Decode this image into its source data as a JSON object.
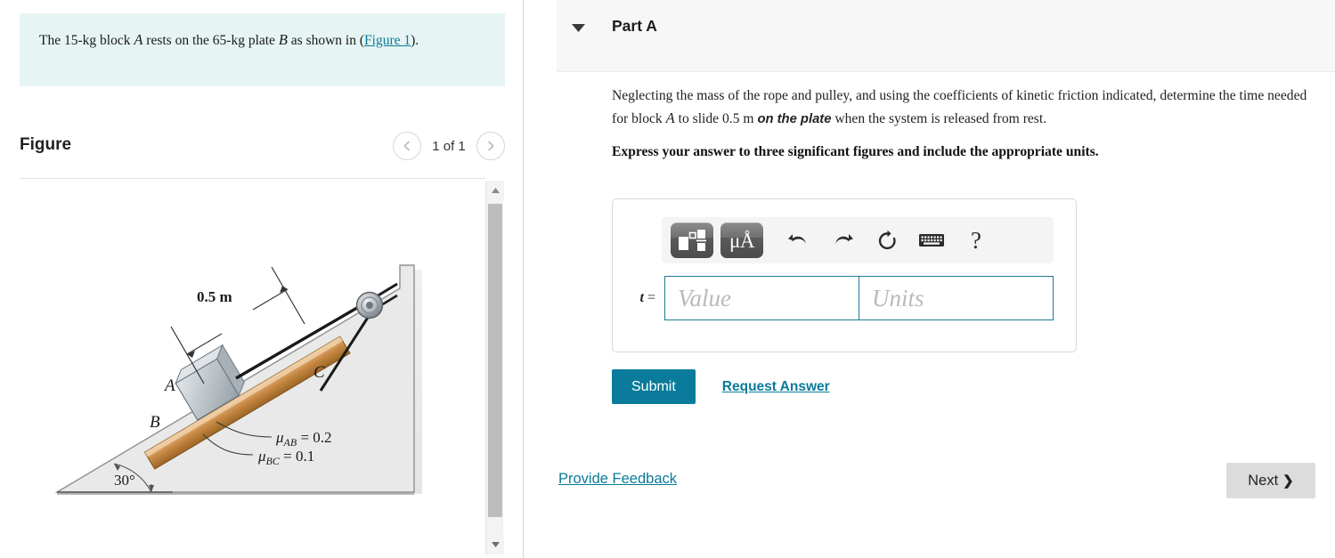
{
  "left": {
    "problem": {
      "segment1": "The 15-",
      "unit1": "kg",
      "segment2": " block ",
      "var_a": "A",
      "segment3": " rests on the 65-",
      "unit2": "kg",
      "segment4": " plate ",
      "var_b": "B",
      "segment5": " as shown in (",
      "figure_link": "Figure 1",
      "segment6": ")."
    },
    "figure": {
      "title": "Figure",
      "counter": "1 of 1",
      "prev_icon": "chevron-left-icon",
      "next_icon": "chevron-right-icon",
      "labels": {
        "distance": "0.5 m",
        "block_a": "A",
        "plate_b": "B",
        "incline_c": "C",
        "mu_ab": "μ",
        "mu_ab_sub": "AB",
        "mu_ab_val": " = 0.2",
        "mu_bc": "μ",
        "mu_bc_sub": "BC",
        "mu_bc_val": " = 0.1",
        "angle": "30°"
      }
    },
    "scrollbar": {
      "up_icon": "triangle-up-icon",
      "down_icon": "triangle-down-icon"
    }
  },
  "right": {
    "part": {
      "title": "Part A",
      "caret_icon": "triangle-down-icon"
    },
    "question": {
      "line1": "Neglecting the mass of the rope and pulley, and using the coefficients of kinetic friction indicated, determine the time needed for block ",
      "var_a": "A",
      "line2": " to slide 0.5 ",
      "unit_m": "m",
      "emphasis": "on the plate",
      "line3": " when the system is released from rest.",
      "express": "Express your answer to three significant figures and include the appropriate units."
    },
    "toolbar": {
      "template_icon": "math-template-icon",
      "units_icon": "micro-angstrom-icon",
      "units_label": "μÅ",
      "undo_icon": "undo-arrow-icon",
      "redo_icon": "redo-arrow-icon",
      "reset_icon": "reset-circular-arrow-icon",
      "keyboard_icon": "keyboard-icon",
      "help_icon": "question-mark-icon",
      "help_label": "?"
    },
    "answer": {
      "label_var": "t",
      "label_eq": " =",
      "value_placeholder": "Value",
      "units_placeholder": "Units",
      "value": "",
      "units": ""
    },
    "actions": {
      "submit": "Submit",
      "request_answer": "Request Answer",
      "provide_feedback": "Provide Feedback",
      "next": "Next",
      "next_icon": "chevron-right-icon"
    }
  },
  "colors": {
    "accent_teal": "#0a7b9a",
    "info_bg": "#e6f4f4",
    "header_bg": "#f7f7f7",
    "input_border": "#1f7a93",
    "next_bg": "#dcdcdc"
  }
}
